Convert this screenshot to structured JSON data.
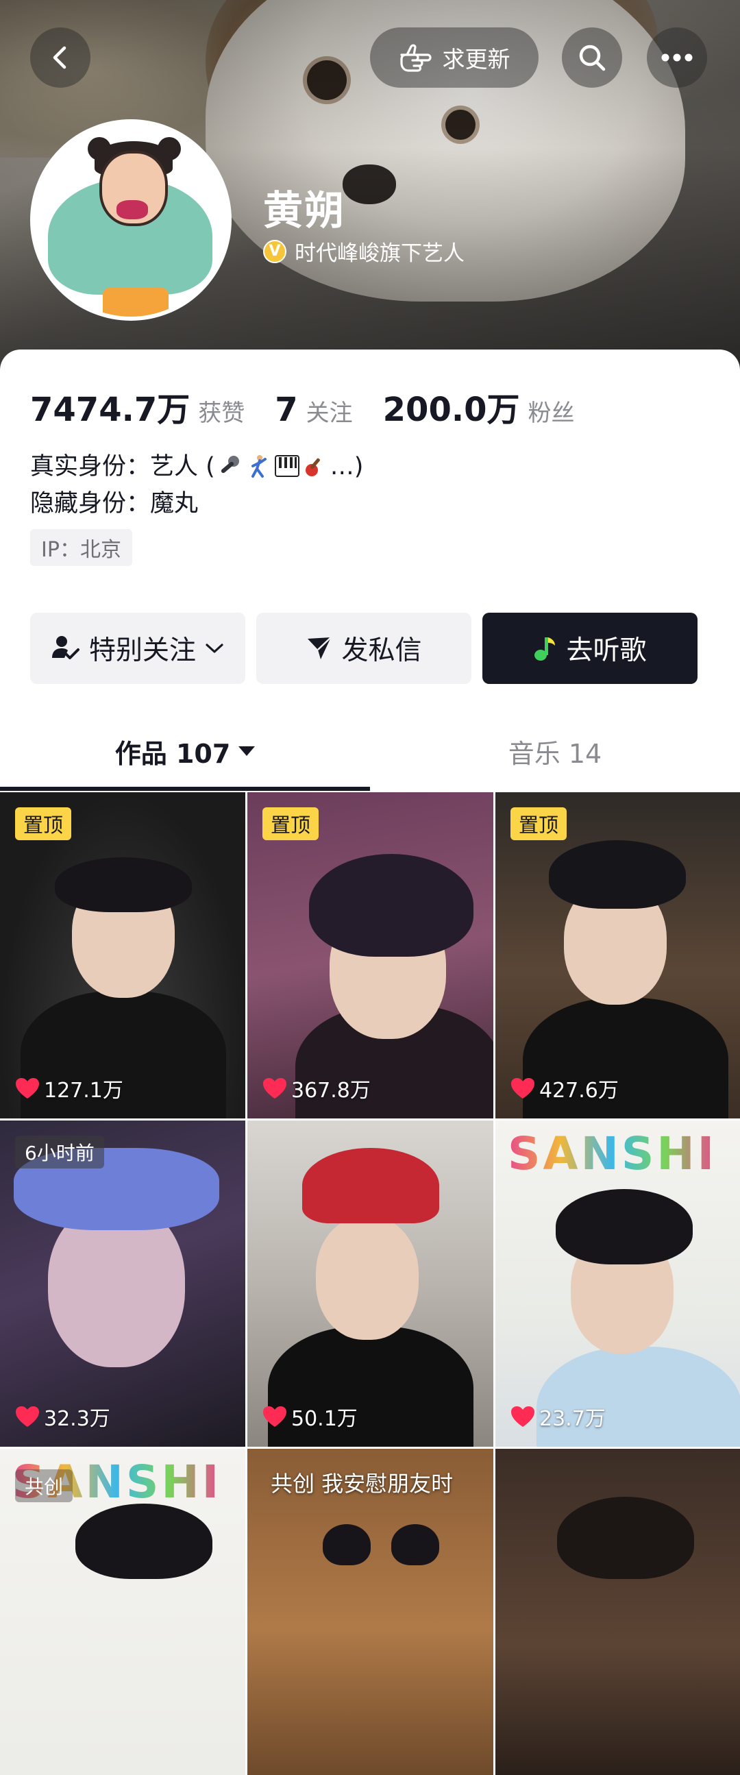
{
  "header": {
    "request_update_label": "求更新",
    "name": "黄朔",
    "verify_badge": "V",
    "verify_text": "时代峰峻旗下艺人"
  },
  "stats": [
    {
      "num": "7474.7万",
      "label": "获赞"
    },
    {
      "num": "7",
      "label": "关注"
    },
    {
      "num": "200.0万",
      "label": "粉丝"
    }
  ],
  "bio": {
    "line1_prefix": "真实身份：艺人 (",
    "line1_suffix": "…)",
    "emojis": [
      "microphone-emoji",
      "dancer-emoji",
      "piano-emoji",
      "guitar-emoji"
    ],
    "line2": "隐藏身份：魔丸",
    "ip": "IP：北京"
  },
  "actions": {
    "follow_label": "特别关注",
    "message_label": "发私信",
    "music_label": "去听歌"
  },
  "tabs": [
    {
      "label": "作品 107",
      "active": true
    },
    {
      "label": "音乐 14",
      "active": false
    }
  ],
  "grid": [
    {
      "badge": "置顶",
      "likes": "127.1万"
    },
    {
      "badge": "置顶",
      "likes": "367.8万"
    },
    {
      "badge": "置顶",
      "likes": "427.6万"
    },
    {
      "time": "6小时前",
      "likes": "32.3万"
    },
    {
      "likes": "50.1万"
    },
    {
      "brand": "SANSHI",
      "likes": "23.7万"
    },
    {
      "brand": "SANSHI",
      "tag": "共创"
    },
    {
      "caption": "共创 我安慰朋友时"
    },
    {}
  ],
  "colors": {
    "accent_text": "#161823",
    "pin_badge": "#fcd447",
    "like_heart": "#fe2c55",
    "verify_gold": "#f7c53a"
  }
}
